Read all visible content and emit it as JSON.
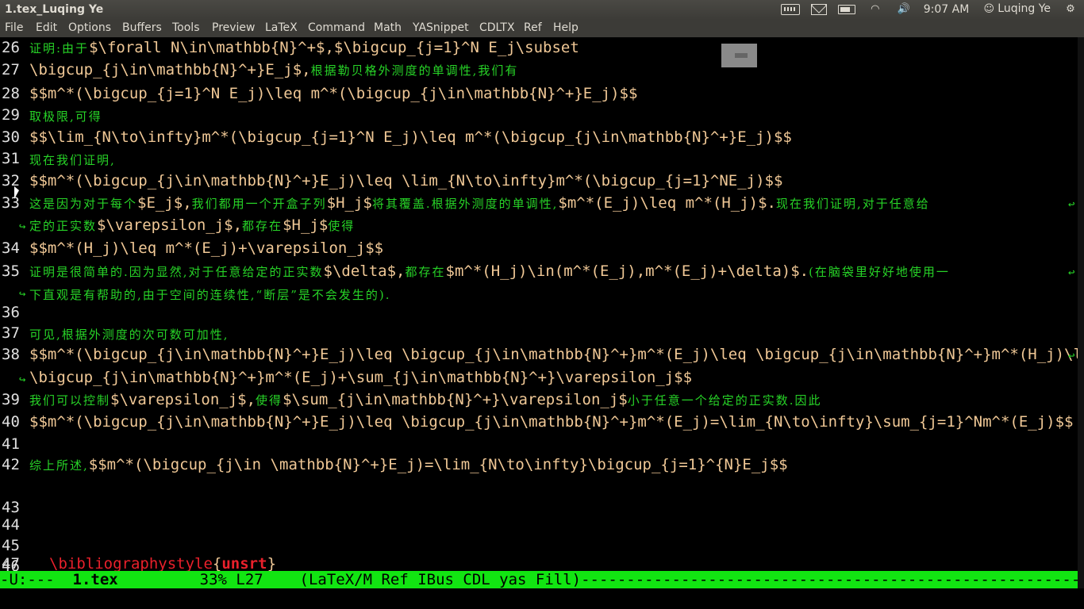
{
  "window": {
    "title": "1.tex_Luqing Ye"
  },
  "system": {
    "clock": "9:07 AM",
    "user": "Luqing Ye"
  },
  "menu": [
    "File",
    "Edit",
    "Options",
    "Buffers",
    "Tools",
    "Preview",
    "LaTeX",
    "Command",
    "Math",
    "YASnippet",
    "CDLTX",
    "Ref",
    "Help"
  ],
  "lines": {
    "n26": "26",
    "n27": "27",
    "n28": "28",
    "n29": "29",
    "n30": "30",
    "n31": "31",
    "n32": "32",
    "n33": "33",
    "n34": "34",
    "n35": "35",
    "n36": "36",
    "n37": "37",
    "n38": "38",
    "n39": "39",
    "n40": "40",
    "n41": "41",
    "n42": "42",
    "n43": "43",
    "n44": "44",
    "n45": "45",
    "n46": "46",
    "n47": "47",
    "l26a": "证明:由于",
    "l26b": "$\\forall N\\in\\mathbb{N}^+$,$\\bigcup_{j=1}^N E_j\\subset",
    "l27a": "\\bigcup_{j\\in\\mathbb{N}^+}E_j$,",
    "l27b": "根据勒贝格外测度的单调性,我们有",
    "l28": "$$m^*(\\bigcup_{j=1}^N E_j)\\leq m^*(\\bigcup_{j\\in\\mathbb{N}^+}E_j)$$",
    "l29": "取极限,可得",
    "l30": "$$\\lim_{N\\to\\infty}m^*(\\bigcup_{j=1}^N E_j)\\leq m^*(\\bigcup_{j\\in\\mathbb{N}^+}E_j)$$",
    "l31": "现在我们证明,",
    "l32": "$$m^*(\\bigcup_{j\\in\\mathbb{N}^+}E_j)\\leq \\lim_{N\\to\\infty}m^*(\\bigcup_{j=1}^NE_j)$$",
    "l33a": "这是因为对于每个",
    "l33b": "$E_j$,",
    "l33c": "我们都用一个开盒子列",
    "l33d": "$H_j$",
    "l33e": "将其覆盖.根据外测度的单调性,",
    "l33f": "$m^*(E_j)\\leq m^*(H_j)$.",
    "l33g": "现在我们证明,对于任意给",
    "l33h": "定的正实数",
    "l33i": "$\\varepsilon_j$,",
    "l33j": "都存在",
    "l33k": "$H_j$",
    "l33l": "使得",
    "l34": "$$m^*(H_j)\\leq m^*(E_j)+\\varepsilon_j$$",
    "l35a": "证明是很简单的.因为显然,对于任意给定的正实数",
    "l35b": "$\\delta$,",
    "l35c": "都存在",
    "l35d": "$m^*(H_j)\\in(m^*(E_j),m^*(E_j)+\\delta)$.",
    "l35e": "(在脑袋里好好地使用一",
    "l35f": "下直观是有帮助的,由于空间的连续性,“断层”是不会发生的).",
    "l37": "可见,根据外测度的次可数可加性,",
    "l38a": "$$m^*(\\bigcup_{j\\in\\mathbb{N}^+}E_j)\\leq \\bigcup_{j\\in\\mathbb{N}^+}m^*(E_j)\\leq \\bigcup_{j\\in\\mathbb{N}^+}m^*(H_j)\\leq",
    "l38b": "\\bigcup_{j\\in\\mathbb{N}^+}m^*(E_j)+\\sum_{j\\in\\mathbb{N}^+}\\varepsilon_j$$",
    "l39a": "我们可以控制",
    "l39b": "$\\varepsilon_j$,",
    "l39c": "使得",
    "l39d": "$\\sum_{j\\in\\mathbb{N}^+}\\varepsilon_j$",
    "l39e": "小于任意一个给定的正实数.因此",
    "l40": "$$m^*(\\bigcup_{j\\in\\mathbb{N}^+}E_j)\\leq \\bigcup_{j\\in\\mathbb{N}^+}m^*(E_j)=\\lim_{N\\to\\infty}\\sum_{j=1}^Nm^*(E_j)$$",
    "l42a": "综上所述,",
    "l42b": "$$m^*(\\bigcup_{j\\in \\mathbb{N}^+}E_j)=\\lim_{N\\to\\infty}\\bigcup_{j=1}^{N}E_j$$",
    "l47a": "\\bibliographystyle",
    "l47b": "{",
    "l47c": "unsrt",
    "l47d": "}"
  },
  "modeline": {
    "state": "-U:---  ",
    "buffer": "1.tex",
    "position": "         33% L27    ",
    "modes": "(LaTeX/M Ref IBus CDL yas Fill)",
    "fill": "----------------------------------------------------------------------------------------------------------------"
  },
  "colors": {
    "text": "#f0c896",
    "comment_cn": "#27d327",
    "keyword": "#e8202b",
    "modeline": "#12e512",
    "panel": "#3c3b37"
  }
}
